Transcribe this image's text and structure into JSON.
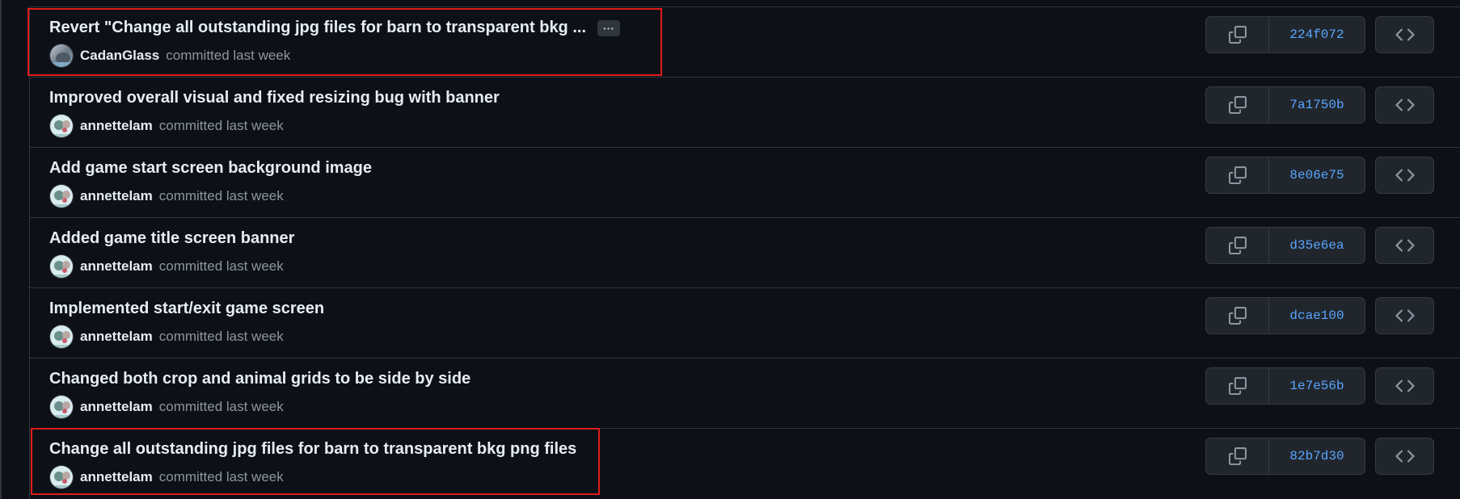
{
  "meta_suffix": "committed last week",
  "expand_label": "···",
  "highlight_color": "#e11b1b",
  "commits": [
    {
      "title": "Revert \"Change all outstanding jpg files for barn to transparent bkg ...",
      "author": "CadanGlass",
      "sha": "224f072",
      "has_expand": true
    },
    {
      "title": "Improved overall visual and fixed resizing bug with banner",
      "author": "annettelam",
      "sha": "7a1750b",
      "has_expand": false
    },
    {
      "title": "Add game start screen background image",
      "author": "annettelam",
      "sha": "8e06e75",
      "has_expand": false
    },
    {
      "title": "Added game title screen banner",
      "author": "annettelam",
      "sha": "d35e6ea",
      "has_expand": false
    },
    {
      "title": "Implemented start/exit game screen",
      "author": "annettelam",
      "sha": "dcae100",
      "has_expand": false
    },
    {
      "title": "Changed both crop and animal grids to be side by side",
      "author": "annettelam",
      "sha": "1e7e56b",
      "has_expand": false
    },
    {
      "title": "Change all outstanding jpg files for barn to transparent bkg png files",
      "author": "annettelam",
      "sha": "82b7d30",
      "has_expand": false
    }
  ]
}
